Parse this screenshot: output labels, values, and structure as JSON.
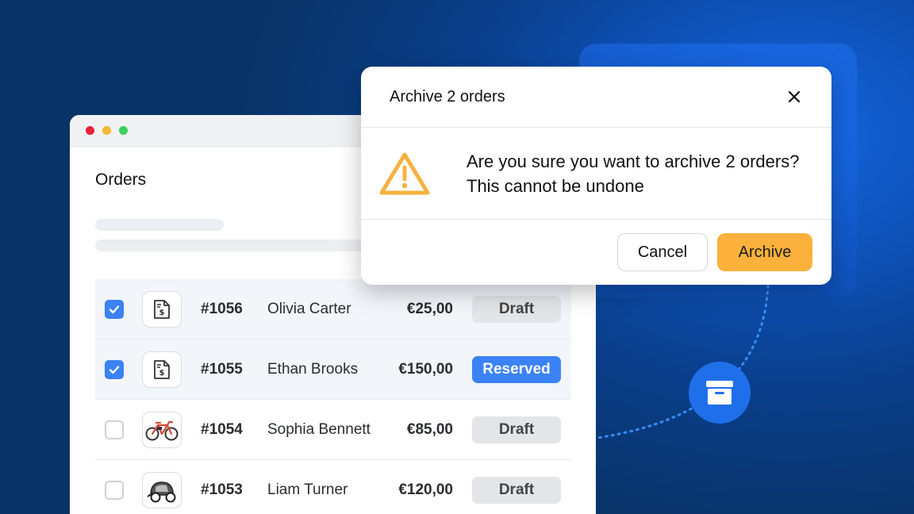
{
  "window": {
    "title": "Orders",
    "rows": [
      {
        "id": "#1056",
        "customer": "Olivia Carter",
        "amount": "€25,00",
        "status": "Draft",
        "checked": true,
        "thumb": "invoice-icon"
      },
      {
        "id": "#1055",
        "customer": "Ethan Brooks",
        "amount": "€150,00",
        "status": "Reserved",
        "checked": true,
        "thumb": "invoice-icon"
      },
      {
        "id": "#1054",
        "customer": "Sophia Bennett",
        "amount": "€85,00",
        "status": "Draft",
        "checked": false,
        "thumb": "bicycle-icon"
      },
      {
        "id": "#1053",
        "customer": "Liam Turner",
        "amount": "€120,00",
        "status": "Draft",
        "checked": false,
        "thumb": "bike-trailer-icon"
      }
    ]
  },
  "modal": {
    "title": "Archive 2 orders",
    "message_line1": "Are you sure you want to archive 2 orders?",
    "message_line2": "This cannot be undone",
    "cancel_label": "Cancel",
    "archive_label": "Archive"
  },
  "colors": {
    "accent_blue": "#3b82f6",
    "archive_orange": "#fbb13c",
    "warning_orange": "#f6b13f",
    "fab_blue": "#1f6fea"
  }
}
